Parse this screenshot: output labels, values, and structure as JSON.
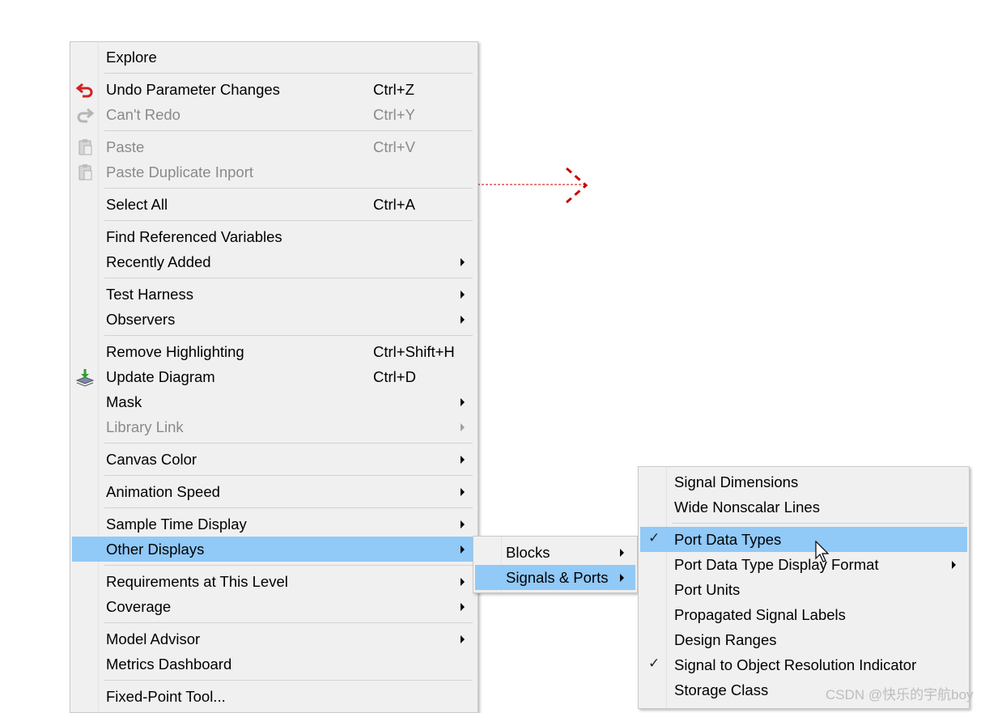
{
  "main_menu": {
    "items": [
      {
        "label": "Explore",
        "shortcut": ""
      },
      {
        "label": "Undo Parameter Changes",
        "shortcut": "Ctrl+Z",
        "icon": "undo-icon"
      },
      {
        "label": "Can't Redo",
        "shortcut": "Ctrl+Y",
        "icon": "redo-icon",
        "disabled": true
      },
      {
        "label": "Paste",
        "shortcut": "Ctrl+V",
        "icon": "paste-icon",
        "disabled": true
      },
      {
        "label": "Paste Duplicate Inport",
        "shortcut": "",
        "icon": "paste-icon",
        "disabled": true
      },
      {
        "label": "Select All",
        "shortcut": "Ctrl+A"
      },
      {
        "label": "Find Referenced Variables",
        "shortcut": ""
      },
      {
        "label": "Recently Added",
        "submenu": true
      },
      {
        "label": "Test Harness",
        "submenu": true
      },
      {
        "label": "Observers",
        "submenu": true
      },
      {
        "label": "Remove Highlighting",
        "shortcut": "Ctrl+Shift+H"
      },
      {
        "label": "Update Diagram",
        "shortcut": "Ctrl+D",
        "icon": "update-diagram-icon"
      },
      {
        "label": "Mask",
        "submenu": true
      },
      {
        "label": "Library Link",
        "submenu": true,
        "disabled": true
      },
      {
        "label": "Canvas Color",
        "submenu": true
      },
      {
        "label": "Animation Speed",
        "submenu": true
      },
      {
        "label": "Sample Time Display",
        "submenu": true
      },
      {
        "label": "Other Displays",
        "submenu": true,
        "highlighted": true
      },
      {
        "label": "Requirements at This Level",
        "submenu": true
      },
      {
        "label": "Coverage",
        "submenu": true
      },
      {
        "label": "Model Advisor",
        "submenu": true
      },
      {
        "label": "Metrics Dashboard"
      },
      {
        "label": "Fixed-Point Tool..."
      }
    ]
  },
  "other_displays_menu": {
    "items": [
      {
        "label": "Blocks",
        "submenu": true
      },
      {
        "label": "Signals & Ports",
        "submenu": true,
        "highlighted": true
      }
    ]
  },
  "signals_ports_menu": {
    "items": [
      {
        "label": "Signal Dimensions"
      },
      {
        "label": "Wide Nonscalar Lines"
      },
      {
        "label": "Port Data Types",
        "checked": true,
        "highlighted": true
      },
      {
        "label": "Port Data Type Display Format",
        "submenu": true
      },
      {
        "label": "Port Units"
      },
      {
        "label": "Propagated Signal Labels"
      },
      {
        "label": "Design Ranges"
      },
      {
        "label": "Signal to Object Resolution Indicator",
        "checked": true
      },
      {
        "label": "Storage Class"
      }
    ]
  },
  "check_mark": "✓",
  "watermark": "CSDN @快乐的宇航boy",
  "colors": {
    "menu_bg": "#f0f0f0",
    "highlight": "#91c9f7",
    "disabled_text": "#8a8a8a",
    "signal_line": "#cc0000"
  }
}
